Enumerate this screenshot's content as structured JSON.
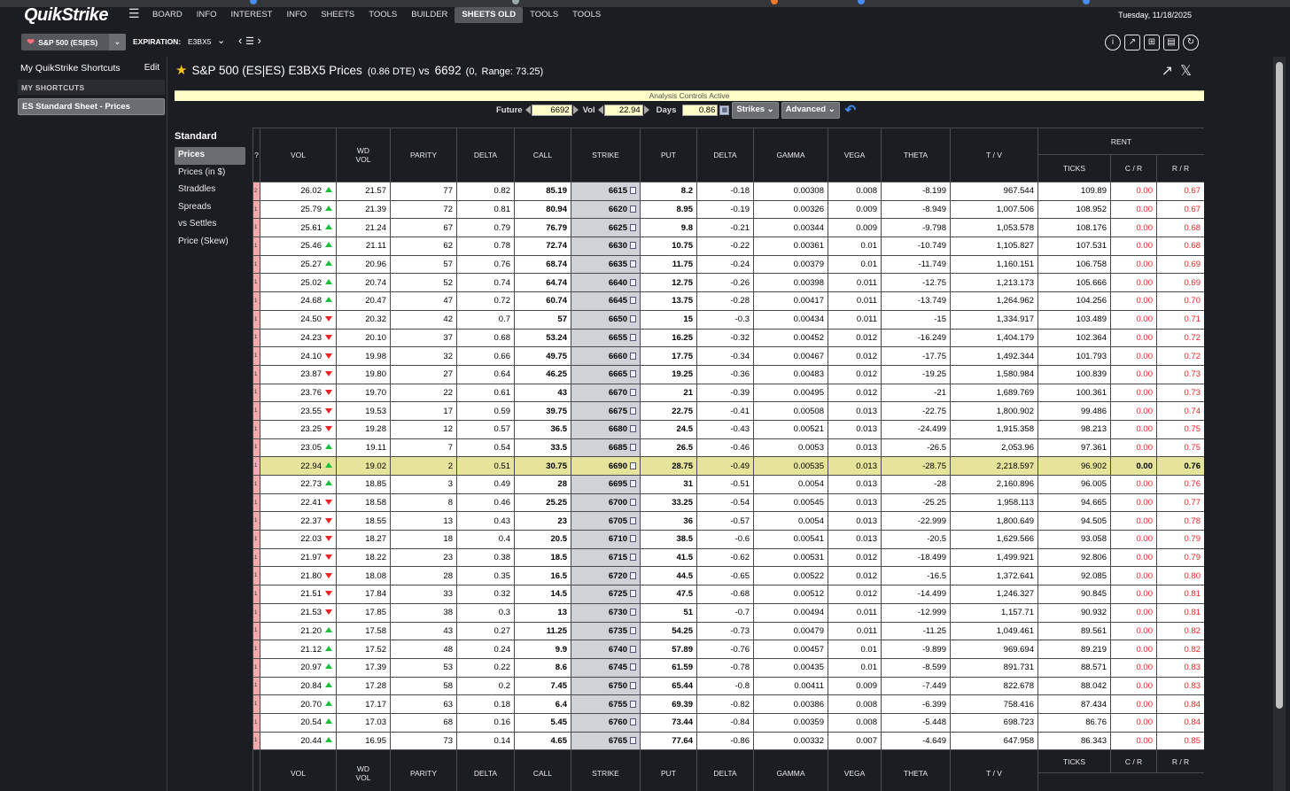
{
  "nav": {
    "logo": "QuikStrike",
    "items": [
      "BOARD",
      "INFO",
      "INTEREST",
      "INFO",
      "SHEETS",
      "TOOLS",
      "BUILDER",
      "SHEETS OLD",
      "TOOLS",
      "TOOLS"
    ],
    "active_index": 7,
    "date": "Tuesday, 11/18/2025"
  },
  "toolbar": {
    "product": "S&P 500 (ES|ES)",
    "expiration_label": "EXPIRATION:",
    "expiration_value": "E3BX5"
  },
  "sidebar": {
    "header": "My QuikStrike Shortcuts",
    "edit": "Edit",
    "section": "MY SHORTCUTS",
    "item": "ES Standard Sheet - Prices"
  },
  "title": {
    "main": "S&P 500 (ES|ES) E3BX5 Prices",
    "dte": "(0.86 DTE)",
    "vs": "vs",
    "future": "6692",
    "change": "(0,",
    "range": "Range: 73.25)"
  },
  "analysis_bar": "Analysis Controls Active",
  "controls": {
    "future_label": "Future",
    "future_value": "6692",
    "vol_label": "Vol",
    "vol_value": "22.94",
    "days_label": "Days",
    "days_value": "0.86",
    "strikes_btn": "Strikes",
    "advanced_btn": "Advanced"
  },
  "views": {
    "title": "Standard",
    "items": [
      "Prices",
      "Prices (in $)",
      "Straddles",
      "Spreads",
      "vs Settles",
      "Price (Skew)"
    ],
    "active_index": 0
  },
  "grid": {
    "headers": {
      "q": "?",
      "vol": "VOL",
      "wd_vol_1": "WD",
      "wd_vol_2": "VOL",
      "parity": "PARITY",
      "delta": "DELTA",
      "call": "CALL",
      "strike": "STRIKE",
      "put": "PUT",
      "delta2": "DELTA",
      "gamma": "GAMMA",
      "vega": "VEGA",
      "theta": "THETA",
      "tv": "T / V",
      "rent": "RENT",
      "ticks": "TICKS",
      "cr": "C / R",
      "rr": "R / R"
    },
    "atm_strike": "6690",
    "rows": [
      [
        "2",
        "26.02",
        "up",
        "21.57",
        "77",
        "0.82",
        "85.19",
        "6615",
        "8.2",
        "-0.18",
        "0.00308",
        "0.008",
        "-8.199",
        "967.544",
        "109.89",
        "0.00",
        "0.67"
      ],
      [
        "1",
        "25.79",
        "up",
        "21.39",
        "72",
        "0.81",
        "80.94",
        "6620",
        "8.95",
        "-0.19",
        "0.00326",
        "0.009",
        "-8.949",
        "1,007.506",
        "108.952",
        "0.00",
        "0.67"
      ],
      [
        "1",
        "25.61",
        "up",
        "21.24",
        "67",
        "0.79",
        "76.79",
        "6625",
        "9.8",
        "-0.21",
        "0.00344",
        "0.009",
        "-9.798",
        "1,053.578",
        "108.176",
        "0.00",
        "0.68"
      ],
      [
        "1",
        "25.46",
        "up",
        "21.11",
        "62",
        "0.78",
        "72.74",
        "6630",
        "10.75",
        "-0.22",
        "0.00361",
        "0.01",
        "-10.749",
        "1,105.827",
        "107.531",
        "0.00",
        "0.68"
      ],
      [
        "1",
        "25.27",
        "up",
        "20.96",
        "57",
        "0.76",
        "68.74",
        "6635",
        "11.75",
        "-0.24",
        "0.00379",
        "0.01",
        "-11.749",
        "1,160.151",
        "106.758",
        "0.00",
        "0.69"
      ],
      [
        "1",
        "25.02",
        "up",
        "20.74",
        "52",
        "0.74",
        "64.74",
        "6640",
        "12.75",
        "-0.26",
        "0.00398",
        "0.011",
        "-12.75",
        "1,213.173",
        "105.666",
        "0.00",
        "0.69"
      ],
      [
        "1",
        "24.68",
        "up",
        "20.47",
        "47",
        "0.72",
        "60.74",
        "6645",
        "13.75",
        "-0.28",
        "0.00417",
        "0.011",
        "-13.749",
        "1,264.962",
        "104.256",
        "0.00",
        "0.70"
      ],
      [
        "1",
        "24.50",
        "down",
        "20.32",
        "42",
        "0.7",
        "57",
        "6650",
        "15",
        "-0.3",
        "0.00434",
        "0.011",
        "-15",
        "1,334.917",
        "103.489",
        "0.00",
        "0.71"
      ],
      [
        "1",
        "24.23",
        "down",
        "20.10",
        "37",
        "0.68",
        "53.24",
        "6655",
        "16.25",
        "-0.32",
        "0.00452",
        "0.012",
        "-16.249",
        "1,404.179",
        "102.364",
        "0.00",
        "0.72"
      ],
      [
        "1",
        "24.10",
        "down",
        "19.98",
        "32",
        "0.66",
        "49.75",
        "6660",
        "17.75",
        "-0.34",
        "0.00467",
        "0.012",
        "-17.75",
        "1,492.344",
        "101.793",
        "0.00",
        "0.72"
      ],
      [
        "1",
        "23.87",
        "down",
        "19.80",
        "27",
        "0.64",
        "46.25",
        "6665",
        "19.25",
        "-0.36",
        "0.00483",
        "0.012",
        "-19.25",
        "1,580.984",
        "100.839",
        "0.00",
        "0.73"
      ],
      [
        "1",
        "23.76",
        "down",
        "19.70",
        "22",
        "0.61",
        "43",
        "6670",
        "21",
        "-0.39",
        "0.00495",
        "0.012",
        "-21",
        "1,689.769",
        "100.361",
        "0.00",
        "0.73"
      ],
      [
        "1",
        "23.55",
        "down",
        "19.53",
        "17",
        "0.59",
        "39.75",
        "6675",
        "22.75",
        "-0.41",
        "0.00508",
        "0.013",
        "-22.75",
        "1,800.902",
        "99.486",
        "0.00",
        "0.74"
      ],
      [
        "1",
        "23.25",
        "down",
        "19.28",
        "12",
        "0.57",
        "36.5",
        "6680",
        "24.5",
        "-0.43",
        "0.00521",
        "0.013",
        "-24.499",
        "1,915.358",
        "98.213",
        "0.00",
        "0.75"
      ],
      [
        "1",
        "23.05",
        "up",
        "19.11",
        "7",
        "0.54",
        "33.5",
        "6685",
        "26.5",
        "-0.46",
        "0.0053",
        "0.013",
        "-26.5",
        "2,053.96",
        "97.361",
        "0.00",
        "0.75"
      ],
      [
        "1",
        "22.94",
        "up",
        "19.02",
        "2",
        "0.51",
        "30.75",
        "6690",
        "28.75",
        "-0.49",
        "0.00535",
        "0.013",
        "-28.75",
        "2,218.597",
        "96.902",
        "0.00",
        "0.76"
      ],
      [
        "1",
        "22.73",
        "up",
        "18.85",
        "3",
        "0.49",
        "28",
        "6695",
        "31",
        "-0.51",
        "0.0054",
        "0.013",
        "-28",
        "2,160.896",
        "96.005",
        "0.00",
        "0.76"
      ],
      [
        "1",
        "22.41",
        "down",
        "18.58",
        "8",
        "0.46",
        "25.25",
        "6700",
        "33.25",
        "-0.54",
        "0.00545",
        "0.013",
        "-25.25",
        "1,958.113",
        "94.665",
        "0.00",
        "0.77"
      ],
      [
        "1",
        "22.37",
        "down",
        "18.55",
        "13",
        "0.43",
        "23",
        "6705",
        "36",
        "-0.57",
        "0.0054",
        "0.013",
        "-22.999",
        "1,800.649",
        "94.505",
        "0.00",
        "0.78"
      ],
      [
        "1",
        "22.03",
        "down",
        "18.27",
        "18",
        "0.4",
        "20.5",
        "6710",
        "38.5",
        "-0.6",
        "0.00541",
        "0.013",
        "-20.5",
        "1,629.566",
        "93.058",
        "0.00",
        "0.79"
      ],
      [
        "1",
        "21.97",
        "down",
        "18.22",
        "23",
        "0.38",
        "18.5",
        "6715",
        "41.5",
        "-0.62",
        "0.00531",
        "0.012",
        "-18.499",
        "1,499.921",
        "92.806",
        "0.00",
        "0.79"
      ],
      [
        "1",
        "21.80",
        "down",
        "18.08",
        "28",
        "0.35",
        "16.5",
        "6720",
        "44.5",
        "-0.65",
        "0.00522",
        "0.012",
        "-16.5",
        "1,372.641",
        "92.085",
        "0.00",
        "0.80"
      ],
      [
        "1",
        "21.51",
        "down",
        "17.84",
        "33",
        "0.32",
        "14.5",
        "6725",
        "47.5",
        "-0.68",
        "0.00512",
        "0.012",
        "-14.499",
        "1,246.327",
        "90.845",
        "0.00",
        "0.81"
      ],
      [
        "1",
        "21.53",
        "down",
        "17.85",
        "38",
        "0.3",
        "13",
        "6730",
        "51",
        "-0.7",
        "0.00494",
        "0.011",
        "-12.999",
        "1,157.71",
        "90.932",
        "0.00",
        "0.81"
      ],
      [
        "1",
        "21.20",
        "up",
        "17.58",
        "43",
        "0.27",
        "11.25",
        "6735",
        "54.25",
        "-0.73",
        "0.00479",
        "0.011",
        "-11.25",
        "1,049.461",
        "89.561",
        "0.00",
        "0.82"
      ],
      [
        "1",
        "21.12",
        "up",
        "17.52",
        "48",
        "0.24",
        "9.9",
        "6740",
        "57.89",
        "-0.76",
        "0.00457",
        "0.01",
        "-9.899",
        "969.694",
        "89.219",
        "0.00",
        "0.82"
      ],
      [
        "1",
        "20.97",
        "up",
        "17.39",
        "53",
        "0.22",
        "8.6",
        "6745",
        "61.59",
        "-0.78",
        "0.00435",
        "0.01",
        "-8.599",
        "891.731",
        "88.571",
        "0.00",
        "0.83"
      ],
      [
        "1",
        "20.84",
        "up",
        "17.28",
        "58",
        "0.2",
        "7.45",
        "6750",
        "65.44",
        "-0.8",
        "0.00411",
        "0.009",
        "-7.449",
        "822.678",
        "88.042",
        "0.00",
        "0.83"
      ],
      [
        "1",
        "20.70",
        "up",
        "17.17",
        "63",
        "0.18",
        "6.4",
        "6755",
        "69.39",
        "-0.82",
        "0.00386",
        "0.008",
        "-6.399",
        "758.416",
        "87.434",
        "0.00",
        "0.84"
      ],
      [
        "1",
        "20.54",
        "up",
        "17.03",
        "68",
        "0.16",
        "5.45",
        "6760",
        "73.44",
        "-0.84",
        "0.00359",
        "0.008",
        "-5.448",
        "698.723",
        "86.76",
        "0.00",
        "0.84"
      ],
      [
        "1",
        "20.44",
        "up",
        "16.95",
        "73",
        "0.14",
        "4.65",
        "6765",
        "77.64",
        "-0.86",
        "0.00332",
        "0.007",
        "-4.649",
        "647.958",
        "86.343",
        "0.00",
        "0.85"
      ]
    ]
  }
}
